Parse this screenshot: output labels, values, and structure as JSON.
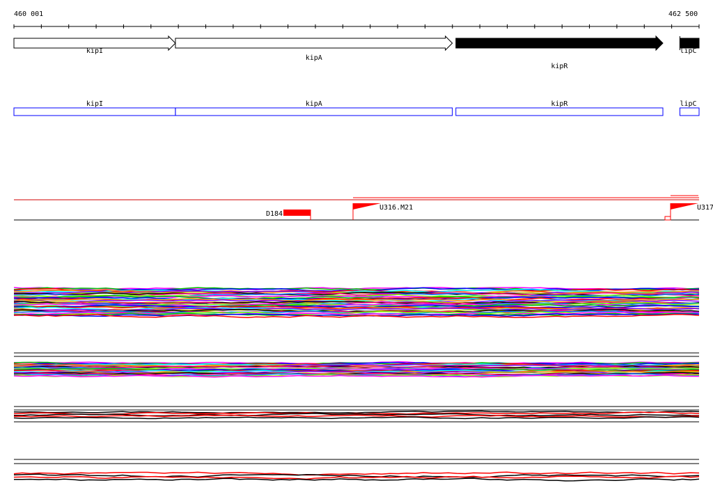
{
  "ruler": {
    "start_label": "460 001",
    "end_label": "462 500",
    "start": 460001,
    "end": 462500
  },
  "genes": [
    {
      "name": "kipI",
      "start": 460001,
      "end": 460590,
      "style": "open"
    },
    {
      "name": "kipA",
      "start": 460590,
      "end": 461600,
      "style": "open"
    },
    {
      "name": "kipR",
      "start": 461613,
      "end": 462368,
      "style": "filled"
    },
    {
      "name": "lipC",
      "start": 462430,
      "end": 462500,
      "style": "filled"
    }
  ],
  "features": [
    {
      "label": "D184"
    },
    {
      "label": "U316.M21"
    },
    {
      "label": "U317"
    }
  ],
  "colors": {
    "gene_box": "#0000ff",
    "feature": "#ff0000",
    "palette": [
      "#ff00ff",
      "#00c000",
      "#0000ff",
      "#ff0000",
      "#00ffff",
      "#ff8000",
      "#8000ff",
      "#c0c000",
      "#000000",
      "#ff0080",
      "#0080ff",
      "#80ff00"
    ]
  }
}
